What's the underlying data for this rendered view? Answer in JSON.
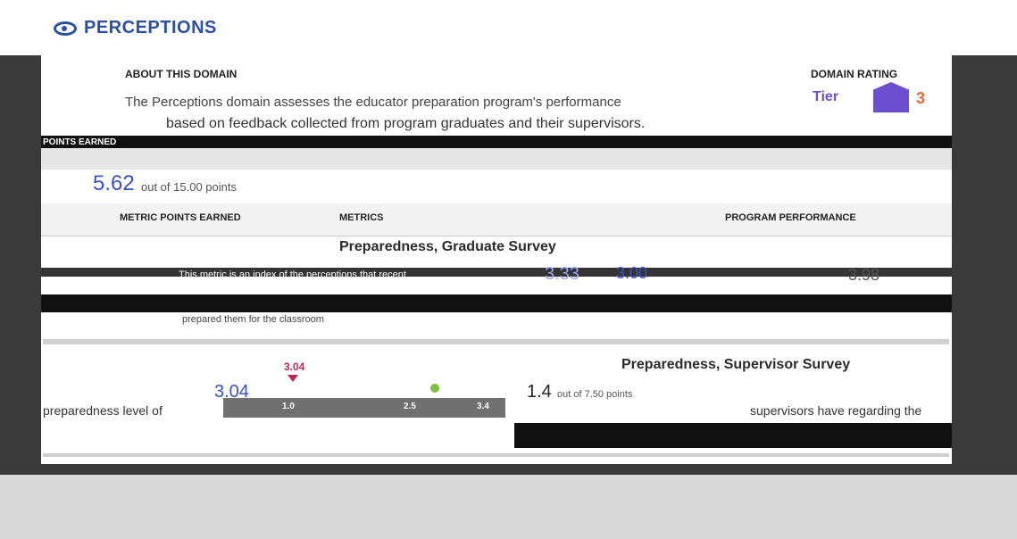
{
  "section": {
    "title": "PERCEPTIONS",
    "icon": "eye-icon"
  },
  "about": {
    "label": "ABOUT THIS DOMAIN",
    "text": "The Perceptions domain assesses the educator preparation program's performance",
    "text2": "based on feedback collected from program graduates and their supervisors."
  },
  "rating": {
    "label": "DOMAIN RATING",
    "tier": "Tier",
    "value": "3"
  },
  "points": {
    "label": "POINTS EARNED",
    "value": "5.62",
    "out_of": "out of 15.00 points"
  },
  "table": {
    "headers": [
      "METRIC POINTS EARNED",
      "METRICS",
      "PROGRAM PERFORMANCE"
    ]
  },
  "metric1": {
    "title": "Preparedness, Graduate Survey",
    "desc": "This metric is an index of the perceptions that recent",
    "desc2": "prepared them for the classroom",
    "score": "3.33",
    "gauge": [
      "3.00",
      "3.98"
    ]
  },
  "metric2": {
    "title": "Preparedness, Supervisor Survey",
    "marker_value": "3.04",
    "score": "3.04",
    "points": "1.4",
    "out_of": "out of 7.50 points",
    "desc_left": "preparedness level of",
    "desc_right": "supervisors have regarding the",
    "ticks": [
      "1.0",
      "2.5",
      "3.4"
    ]
  },
  "colors": {
    "accent": "#2d4ea5",
    "tier": "#6b4fd0",
    "marker": "#c0245a"
  }
}
